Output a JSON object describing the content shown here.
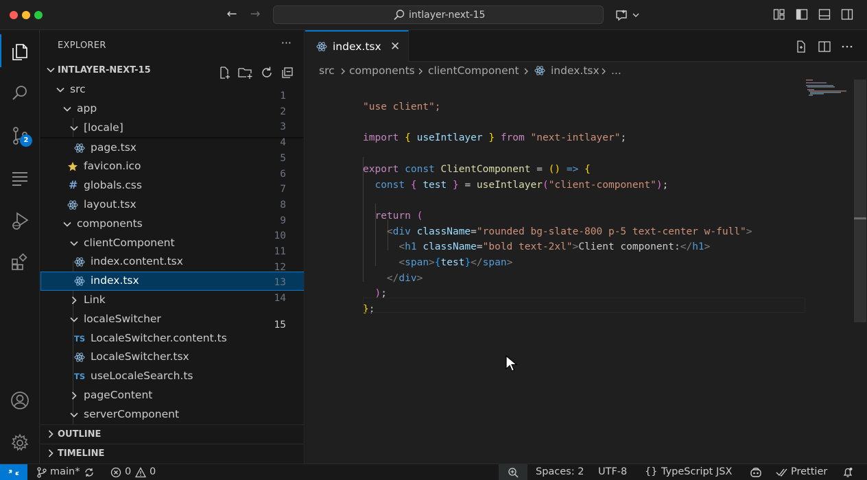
{
  "window": {
    "title": "intlayer-next-15",
    "nav_back": "←",
    "nav_forward": "→"
  },
  "activity_bar": {
    "items": [
      "explorer-icon",
      "search-icon",
      "source-control-icon",
      "outline-icon",
      "run-debug-icon",
      "extensions-icon",
      "account-icon",
      "settings-gear-icon"
    ],
    "source_control_badge": "2"
  },
  "sidebar": {
    "header": "EXPLORER",
    "more": "···",
    "project": "INTLAYER-NEXT-15",
    "tree": [
      {
        "label": "src"
      },
      {
        "label": "app"
      },
      {
        "label": "[locale]"
      },
      {
        "label": "page.tsx"
      },
      {
        "label": "favicon.ico"
      },
      {
        "label": "globals.css"
      },
      {
        "label": "layout.tsx"
      },
      {
        "label": "components"
      },
      {
        "label": "clientComponent"
      },
      {
        "label": "index.content.tsx"
      },
      {
        "label": "index.tsx"
      },
      {
        "label": "Link"
      },
      {
        "label": "localeSwitcher"
      },
      {
        "label": "LocaleSwitcher.content.ts"
      },
      {
        "label": "LocaleSwitcher.tsx"
      },
      {
        "label": "useLocaleSearch.ts"
      },
      {
        "label": "pageContent"
      },
      {
        "label": "serverComponent"
      }
    ],
    "ts_badge": "TS",
    "css_badge": "#",
    "outline": "OUTLINE",
    "timeline": "TIMELINE"
  },
  "editor": {
    "tab": {
      "label": "index.tsx",
      "close": "✕"
    },
    "breadcrumb": [
      "src",
      "components",
      "clientComponent",
      "index.tsx",
      "..."
    ],
    "line_numbers": [
      "1",
      "2",
      "3",
      "4",
      "5",
      "6",
      "7",
      "8",
      "9",
      "10",
      "11",
      "12",
      "13",
      "14",
      "15"
    ],
    "code": {
      "l1": "\"use client\";",
      "l3_import": "import",
      "l3_ob": "{",
      "l3_name": "useIntlayer",
      "l3_cb": "}",
      "l3_from": "from",
      "l3_mod": "\"next-intlayer\"",
      "l3_semi": ";",
      "l5_export": "export",
      "l5_const": "const",
      "l5_name": "ClientComponent",
      "l5_eq": "=",
      "l5_op": "(",
      "l5_cp": ")",
      "l5_arrow": "=>",
      "l5_ob": "{",
      "l6_const": "const",
      "l6_ob": "{",
      "l6_var": "test",
      "l6_cb": "}",
      "l6_eq": "=",
      "l6_fn": "useIntlayer",
      "l6_op": "(",
      "l6_arg": "\"client-component\"",
      "l6_cp": ")",
      "l6_semi": ";",
      "l8_return": "return",
      "l8_op": "(",
      "l9_lt": "<",
      "l9_tag": "div",
      "l9_attr": "className",
      "l9_eq": "=",
      "l9_val": "\"rounded bg-slate-800 p-5 text-center w-full\"",
      "l9_gt": ">",
      "l10_lt": "<",
      "l10_tag": "h1",
      "l10_attr": "className",
      "l10_eq": "=",
      "l10_val": "\"bold text-2xl\"",
      "l10_gt": ">",
      "l10_text": "Client component:",
      "l10_close_lt": "</",
      "l10_close_tag": "h1",
      "l10_close_gt": ">",
      "l11_lt": "<",
      "l11_tag": "span",
      "l11_gt": ">",
      "l11_ob": "{",
      "l11_var": "test",
      "l11_cb": "}",
      "l11_close_lt": "</",
      "l11_close_tag": "span",
      "l11_close_gt": ">",
      "l12_lt": "</",
      "l12_tag": "div",
      "l12_gt": ">",
      "l13_cp": ")",
      "l13_semi": ";",
      "l14_cb": "}",
      "l14_semi": ";"
    }
  },
  "status_bar": {
    "branch": "main*",
    "errors": "0",
    "warnings": "0",
    "spaces": "Spaces: 2",
    "encoding": "UTF-8",
    "language_braces": "{}",
    "language": "TypeScript JSX",
    "formatter": "Prettier"
  },
  "colors": {
    "accent": "#0078d4",
    "selection_bg": "#04395e",
    "editor_bg": "#1f1f1f",
    "sidebar_bg": "#181818"
  }
}
